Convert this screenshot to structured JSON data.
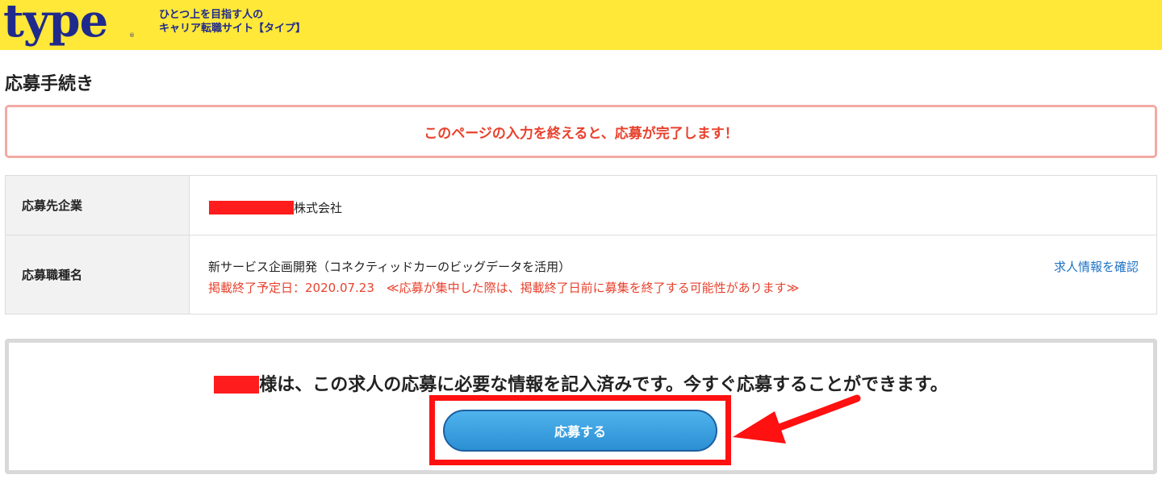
{
  "header": {
    "logo_text": "type",
    "logo_mark": "®",
    "tagline_line1": "ひとつ上を目指す人の",
    "tagline_line2": "キャリア転職サイト【タイプ】"
  },
  "page": {
    "title": "応募手続き",
    "notice": "このページの入力を終えると、応募が完了します！"
  },
  "info_table": {
    "company_label": "応募先企業",
    "company_suffix": "株式会社",
    "job_label": "応募職種名",
    "job_title": "新サービス企画開発（コネクティッドカーのビッグデータを活用）",
    "job_deadline": "掲載終了予定日：2020.07.23　≪応募が集中した際は、掲載終了日前に募集を終了する可能性があります≫",
    "job_link": "求人情報を確認"
  },
  "apply": {
    "message": "様は、この求人の応募に必要な情報を記入済みです。今すぐ応募することができます。",
    "button_label": "応募する"
  },
  "colors": {
    "header_bg": "#ffe838",
    "brand_blue": "#1f2a8c",
    "alert_red": "#e8412d",
    "link_blue": "#1f72c5",
    "button_blue": "#2b8fd4",
    "annotation_red": "#ff1111"
  },
  "icons": {
    "annotation_arrow": "arrow-icon"
  }
}
